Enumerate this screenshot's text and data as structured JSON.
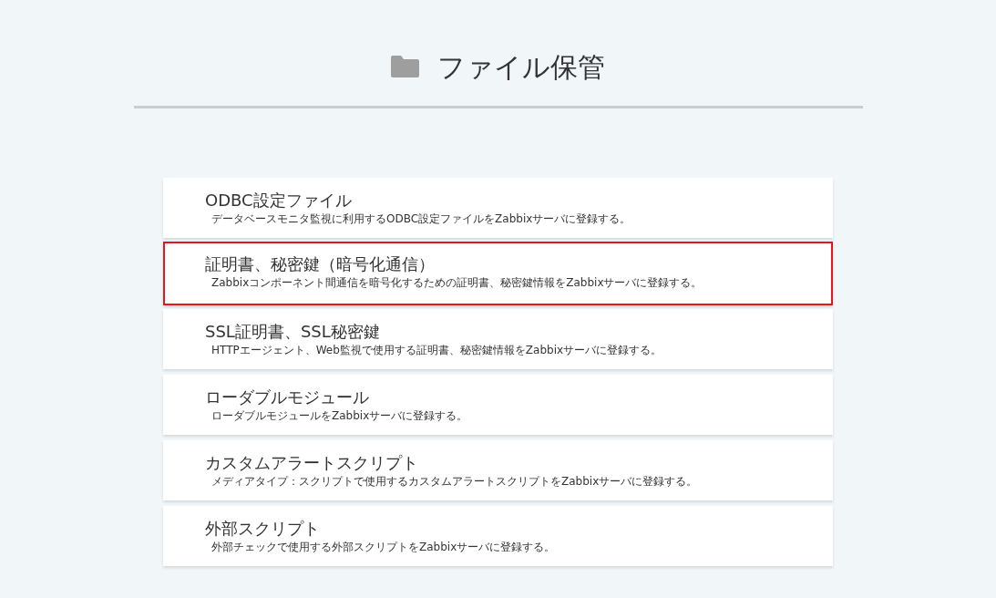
{
  "header": {
    "title": "ファイル保管"
  },
  "items": [
    {
      "title": "ODBC設定ファイル",
      "description": "データベースモニタ監視に利用するODBC設定ファイルをZabbixサーバに登録する。",
      "selected": false
    },
    {
      "title": "証明書、秘密鍵（暗号化通信）",
      "description": "Zabbixコンポーネント間通信を暗号化するための証明書、秘密鍵情報をZabbixサーバに登録する。",
      "selected": true
    },
    {
      "title": "SSL証明書、SSL秘密鍵",
      "description": "HTTPエージェント、Web監視で使用する証明書、秘密鍵情報をZabbixサーバに登録する。",
      "selected": false
    },
    {
      "title": "ローダブルモジュール",
      "description": "ローダブルモジュールをZabbixサーバに登録する。",
      "selected": false
    },
    {
      "title": "カスタムアラートスクリプト",
      "description": "メディアタイプ：スクリプトで使用するカスタムアラートスクリプトをZabbixサーバに登録する。",
      "selected": false
    },
    {
      "title": "外部スクリプト",
      "description": "外部チェックで使用する外部スクリプトをZabbixサーバに登録する。",
      "selected": false
    }
  ]
}
